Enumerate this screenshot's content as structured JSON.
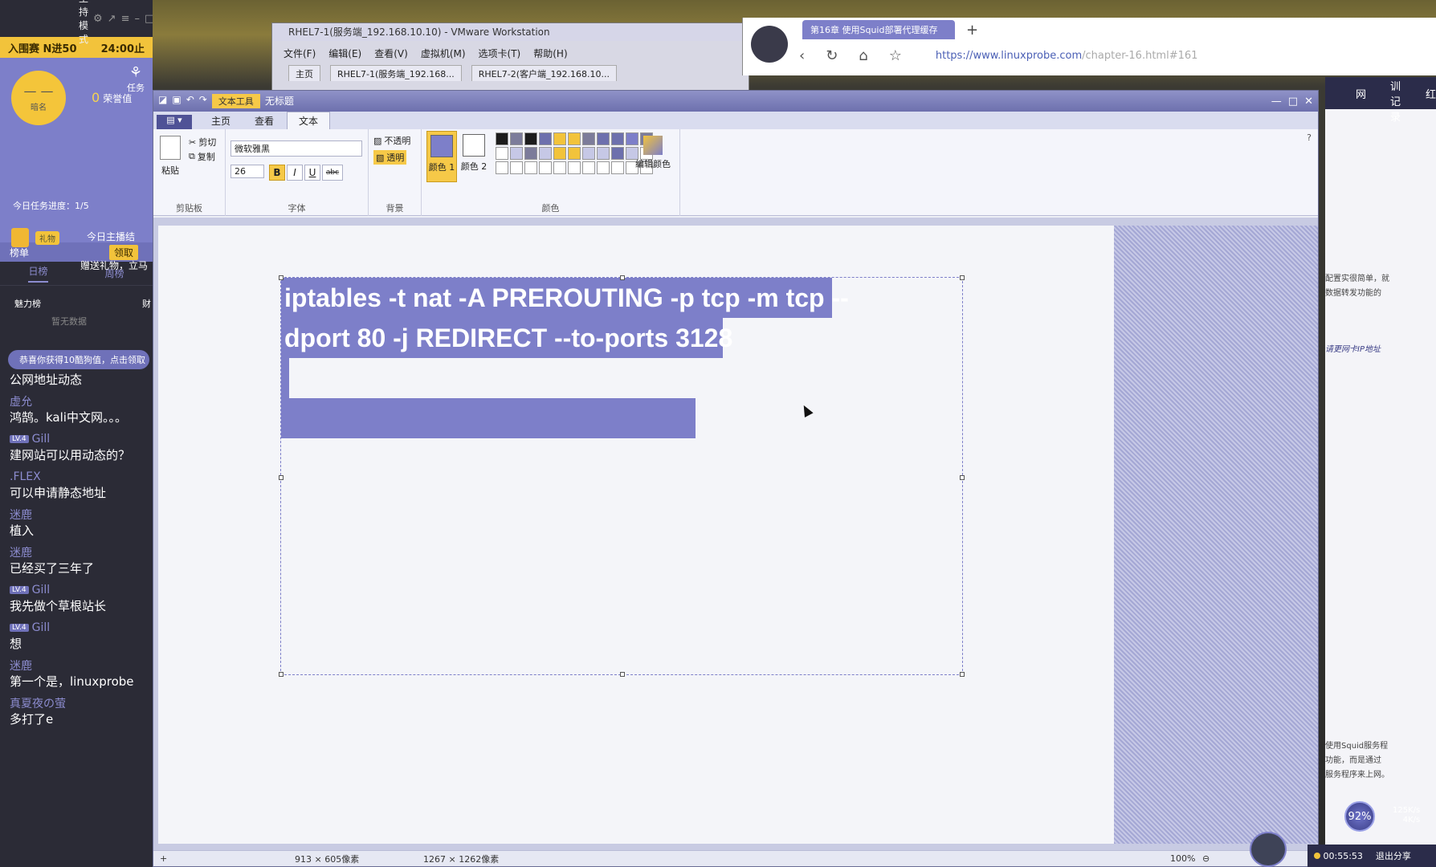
{
  "sidebar": {
    "mode_label": "主持模式",
    "rank_label": "入围赛 N进50",
    "rank_time": "24:00止",
    "avatar_text": "— —",
    "avatar_level": "暗名",
    "honor_value": "0",
    "honor_label": "荣誉值",
    "gift_icon_label": "任务",
    "task_progress": "今日任务进度：1/5",
    "tool_tag": "礼物",
    "today_label": "今日主播结",
    "gift_line": "赠送礼物，立马",
    "board_label": "榜单",
    "board_button": "领取",
    "tab_day": "日榜",
    "tab_week": "周榜",
    "charm_title": "魅力榜",
    "charm_right": "财",
    "no_data": "暂无数据",
    "notice": "恭喜你获得10酷狗值，点击领取",
    "chat": [
      {
        "user": "",
        "badge": "",
        "msg": "公网地址动态"
      },
      {
        "user": "虚允",
        "badge": "",
        "msg": "鸿鹄。kali中文网。。。"
      },
      {
        "user": "Gill",
        "badge": "LV.4",
        "msg": "建网站可以用动态的？"
      },
      {
        "user": ".FLEX",
        "badge": "",
        "msg": "可以申请静态地址"
      },
      {
        "user": "迷鹿",
        "badge": "",
        "msg": "植入"
      },
      {
        "user": "迷鹿",
        "badge": "",
        "msg": "已经买了三年了"
      },
      {
        "user": "Gill",
        "badge": "LV.4",
        "msg": "我先做个草根站长"
      },
      {
        "user": "Gill",
        "badge": "LV.4",
        "msg": "想"
      },
      {
        "user": "迷鹿",
        "badge": "",
        "msg": "第一个是，linuxprobe"
      },
      {
        "user": "真夏夜の萤",
        "badge": "",
        "msg": "多打了e"
      }
    ]
  },
  "vmware": {
    "title": "RHEL7-1(服务端_192.168.10.10) - VMware Workstation",
    "menu": [
      "文件(F)",
      "编辑(E)",
      "查看(V)",
      "虚拟机(M)",
      "选项卡(T)",
      "帮助(H)"
    ],
    "tabs": [
      "主页",
      "RHEL7-1(服务端_192.168...",
      "RHEL7-2(客户端_192.168.10..."
    ]
  },
  "browser": {
    "tab_title": "第16章 使用Squid部署代理缓存",
    "new_tab": "+",
    "url_main": "https://www.linuxprobe.com",
    "url_rest": "/chapter-16.html#161",
    "right_nav": [
      "网",
      "培训记录",
      "红"
    ],
    "right_text_1": "配置实很简单，就",
    "right_text_2": "数据转发功能的",
    "right_text_3": "请更网卡IP地址",
    "right_text_4": "使用Squid服务程",
    "right_text_5": "功能，而是通过",
    "right_text_6": "服务程序来上网。"
  },
  "paint": {
    "context_tab": "文本工具",
    "title_hint": "无标题",
    "tabs": [
      "主页",
      "查看",
      "文本"
    ],
    "file_menu": "▤ ▾",
    "clipboard": {
      "paste": "粘贴",
      "cut": "剪切",
      "copy": "复制",
      "label": "剪贴板"
    },
    "font": {
      "name": "微软雅黑",
      "size": "26",
      "bold": "B",
      "italic": "I",
      "underline": "U",
      "strike": "abc",
      "label": "字体"
    },
    "background": {
      "opaque": "不透明",
      "transparent": "透明",
      "label": "背景"
    },
    "colors": {
      "color1": "颜色 1",
      "color2": "颜色 2",
      "edit": "编辑颜色",
      "label": "颜色",
      "color1_value": "#7d7fc9",
      "color2_value": "#ffffff",
      "palette": [
        "#1c1c1c",
        "#7c7c9a",
        "#1c1c1c",
        "#6d70ad",
        "#f2c33b",
        "#f2c33b",
        "#7c7c9a",
        "#6d70ad",
        "#6d70ad",
        "#7d7fc9",
        "#7c7c9a"
      ],
      "palette_row2": [
        "#ffffff",
        "#c6c8e6",
        "#7c7c9a",
        "#c6c8e6",
        "#f2c33b",
        "#f2c33b",
        "#c6c8e6",
        "#c6c8e6",
        "#6d70ad",
        "#c6c8e6",
        "#ffffff"
      ]
    },
    "text_line1": "iptables -t nat -A PREROUTING  -p tcp -m tcp --",
    "text_line2": "dport 80 -j REDIRECT --to-ports 3128",
    "status_selection": "913 × 605像素",
    "status_canvas": "1267 × 1262像素",
    "status_zoom": "100%"
  },
  "overlay": {
    "speed_percent": "92%",
    "speed_up": "125K/s",
    "speed_down": "4K/s",
    "timer": "00:55:53",
    "exit_share": "退出分享"
  },
  "colors": {
    "accent": "#7d7fc9",
    "gold": "#f2c33b",
    "dark": "#2b2b36"
  }
}
